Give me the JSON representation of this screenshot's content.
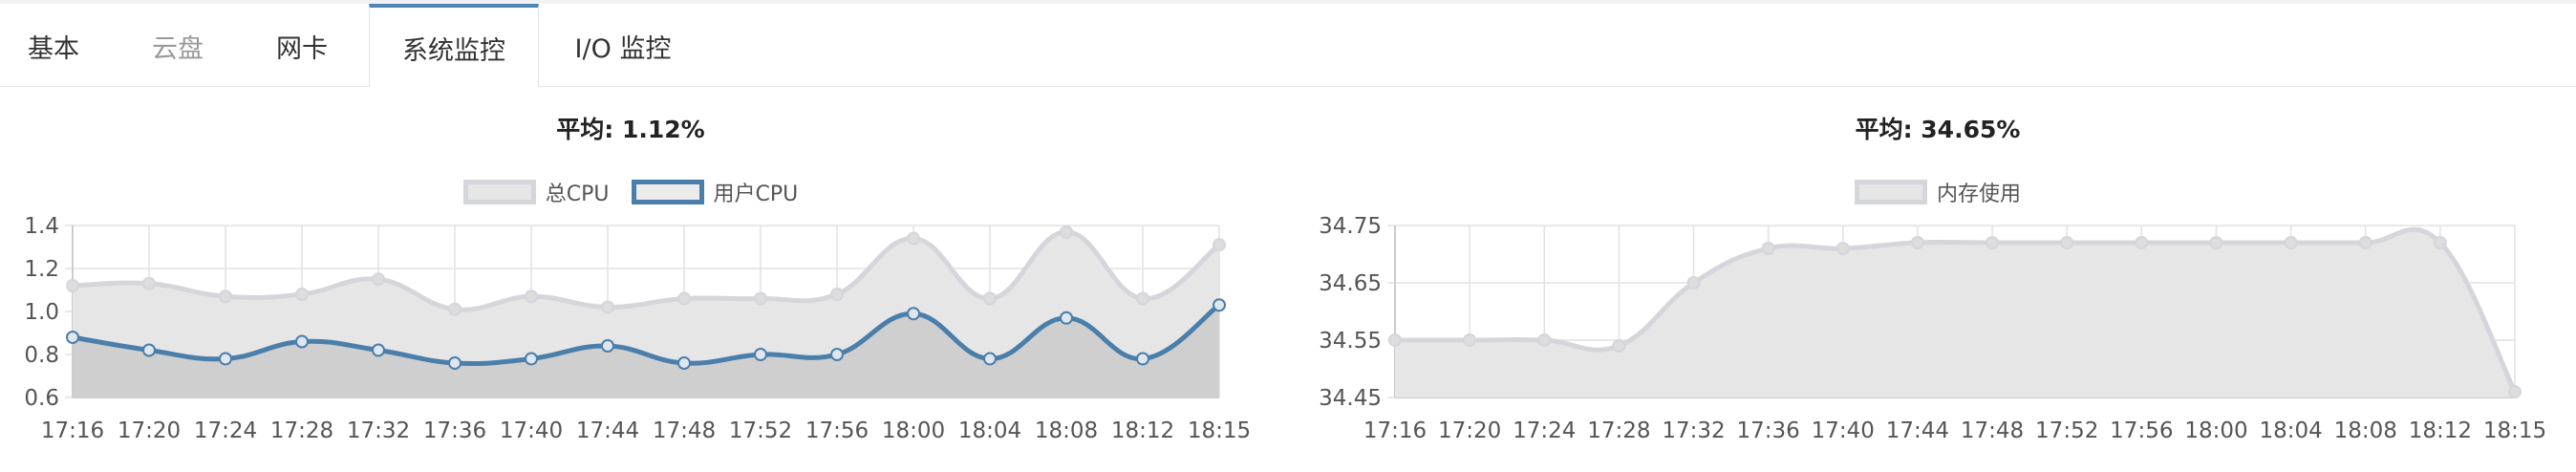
{
  "tabs": [
    {
      "label": "基本",
      "state": "normal"
    },
    {
      "label": "云盘",
      "state": "disabled"
    },
    {
      "label": "网卡",
      "state": "normal"
    },
    {
      "label": "系统监控",
      "state": "active"
    },
    {
      "label": "I/O 监控",
      "state": "normal"
    }
  ],
  "colors": {
    "accent": "#4f85b5",
    "series_blue": "#4a7fab",
    "series_gray_line": "#d4d6dc",
    "fill_gray": "#e6e6e6",
    "fill_dark": "#cfcfcf"
  },
  "chart_data": [
    {
      "type": "area",
      "title": "平均: 1.12%",
      "x": [
        "17:16",
        "17:20",
        "17:24",
        "17:28",
        "17:32",
        "17:36",
        "17:40",
        "17:44",
        "17:48",
        "17:52",
        "17:56",
        "18:00",
        "18:04",
        "18:08",
        "18:12",
        "18:15"
      ],
      "series": [
        {
          "name": "总CPU",
          "values": [
            1.12,
            1.13,
            1.07,
            1.08,
            1.15,
            1.01,
            1.07,
            1.02,
            1.06,
            1.06,
            1.08,
            1.34,
            1.06,
            1.37,
            1.06,
            1.31
          ]
        },
        {
          "name": "用户CPU",
          "values": [
            0.88,
            0.82,
            0.78,
            0.86,
            0.82,
            0.76,
            0.78,
            0.84,
            0.76,
            0.8,
            0.8,
            0.99,
            0.78,
            0.97,
            0.78,
            1.03
          ]
        }
      ],
      "y_ticks": [
        "1.4",
        "1.2",
        "1.0",
        "0.8",
        "0.6"
      ],
      "ylim": [
        0.6,
        1.4
      ],
      "legend": "top-center",
      "grid": true
    },
    {
      "type": "area",
      "title": "平均: 34.65%",
      "x": [
        "17:16",
        "17:20",
        "17:24",
        "17:28",
        "17:32",
        "17:36",
        "17:40",
        "17:44",
        "17:48",
        "17:52",
        "17:56",
        "18:00",
        "18:04",
        "18:08",
        "18:12",
        "18:15"
      ],
      "series": [
        {
          "name": "内存使用",
          "values": [
            34.55,
            34.55,
            34.55,
            34.54,
            34.65,
            34.71,
            34.71,
            34.72,
            34.72,
            34.72,
            34.72,
            34.72,
            34.72,
            34.72,
            34.72,
            34.46
          ]
        }
      ],
      "y_ticks": [
        "34.75",
        "34.65",
        "34.55",
        "34.45"
      ],
      "ylim": [
        34.45,
        34.75
      ],
      "legend": "top-center",
      "grid": true
    }
  ]
}
